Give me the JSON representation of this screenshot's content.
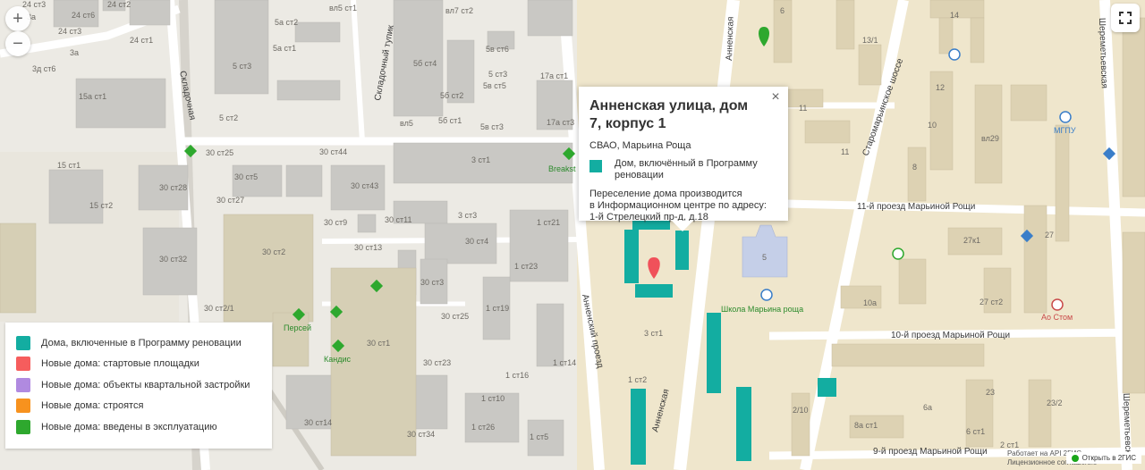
{
  "map": {
    "building_labels": [
      "24 ст3",
      "24 ст6",
      "24 ст2",
      "24 ст1",
      "3д ст6",
      "3а",
      "3а",
      "15а ст1",
      "5 ст3",
      "5 ст2",
      "30 ст25",
      "30 ст5",
      "30 ст28",
      "30 ст27",
      "15 ст1",
      "15 ст2",
      "30 ст32",
      "30 ст2",
      "30 ст2/1",
      "30 ст1",
      "30 ст23",
      "30 ст14",
      "30 ст34",
      "30 ст9",
      "30 ст13",
      "30 ст11",
      "30 ст43",
      "30 ст44",
      "30 ст3",
      "30 ст25",
      "30 ст4",
      "3 ст3",
      "1 ст21",
      "1 ст23",
      "1 ст19",
      "1 ст14",
      "1 ст16",
      "1 ст10",
      "1 ст26",
      "1 ст5",
      "5а ст2",
      "5а ст1",
      "5б ст4",
      "5б ст2",
      "5б ст1",
      "5 ст3",
      "5в ст6",
      "5в ст5",
      "5в ст3",
      "17а ст1",
      "17а ст3",
      "вл7 ст2",
      "вл5 ст1",
      "вл5",
      "3 ст1",
      "3 ст1",
      "1 ст2",
      "6",
      "14",
      "13/1",
      "12",
      "10",
      "8",
      "вл29",
      "27",
      "27к1",
      "27 ст2",
      "10а",
      "23",
      "23/2",
      "6а",
      "8а ст1",
      "6 ст1",
      "2/10",
      "5",
      "11",
      "11",
      "2 ст1"
    ],
    "streets": [
      "Складочная",
      "Складочный тупик",
      "Анненский проезд",
      "Анненская",
      "Шереметьевская",
      "Старомарьинское шоссе",
      "11-й проезд Марьиной Рощи",
      "10-й проезд Марьиной Рощи",
      "9-й проезд Марьиной Рощи"
    ],
    "pois": [
      "Breakst",
      "Персей",
      "Кандис",
      "Школа Марьина роща",
      "МГПУ",
      "Ао Стом"
    ]
  },
  "controls": {
    "zoom_in": "+",
    "zoom_out": "−"
  },
  "popup": {
    "title": "Анненская улица, дом 7, корпус 1",
    "district": "СВАО, Марьина Роща",
    "legend_label": "Дом, включённый в Программу реновации",
    "note_line1": "Переселение дома производится",
    "note_line2": "в Информационном центре по адресу:",
    "note_line3": "1-й Стрелецкий пр-д, д.18",
    "close": "×"
  },
  "legend": {
    "items": [
      {
        "label": "Дома, включенные в Программу реновации",
        "color": "#13ada1"
      },
      {
        "label": "Новые дома: стартовые площадки",
        "color": "#f65d5d"
      },
      {
        "label": "Новые дома: объекты квартальной застройки",
        "color": "#b08ae0"
      },
      {
        "label": "Новые дома: строятся",
        "color": "#f7921e"
      },
      {
        "label": "Новые дома: введены в эксплуатацию",
        "color": "#2ea82e"
      }
    ]
  },
  "attribution": {
    "line1": "Работает на API 2ГИС",
    "line2": "Лицензионное соглашение"
  },
  "open_2gis": "Открыть в 2ГИС",
  "colors": {
    "renovation": "#13ada1",
    "building_gray": "#c9c8c4",
    "building_tan": "#e6dcc0",
    "road": "#ffffff",
    "background": "#eceae4"
  }
}
